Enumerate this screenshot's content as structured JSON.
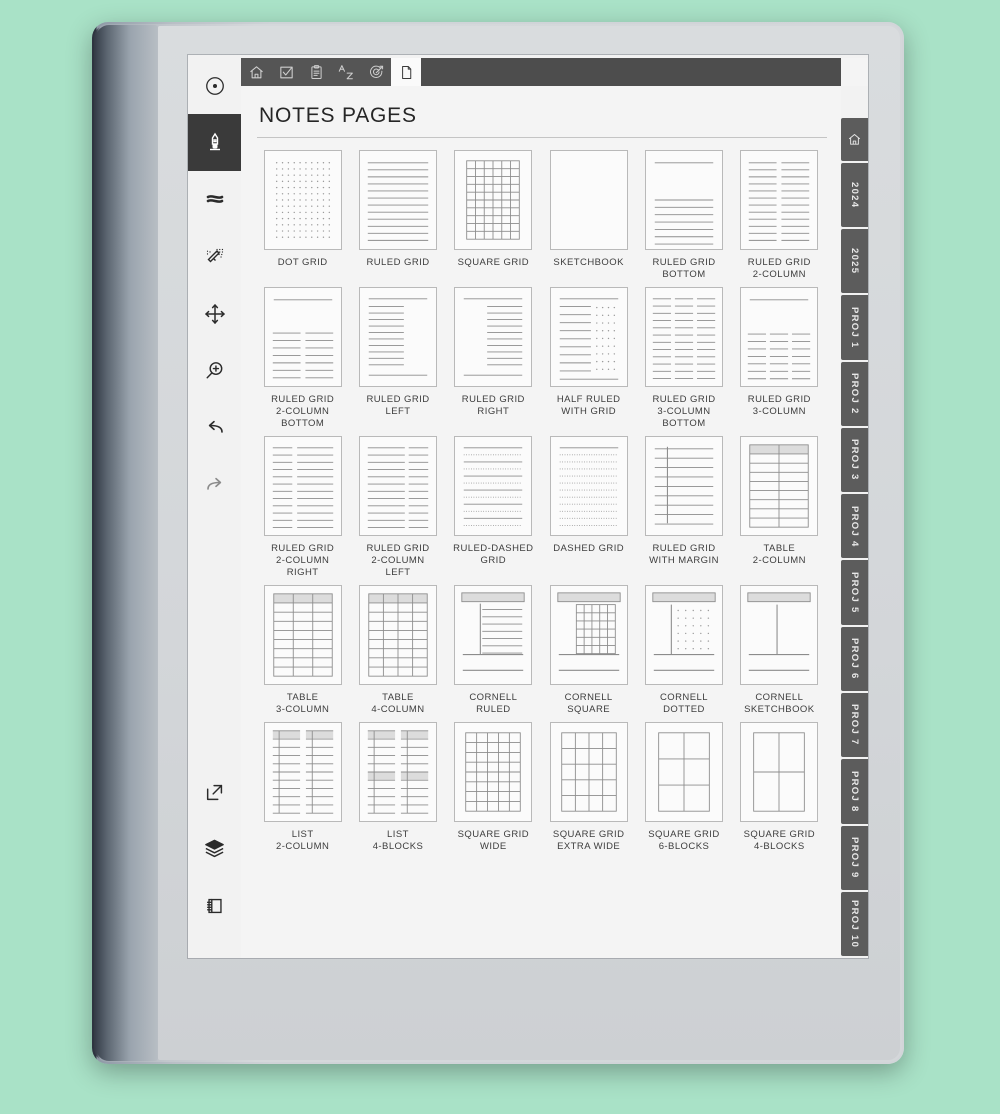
{
  "device": {
    "frame_color": "#d4d7da",
    "background_color": "#a9e2c7"
  },
  "topbar": {
    "tabs": [
      {
        "name": "home-icon",
        "label": "Home",
        "active": false
      },
      {
        "name": "checkbox-icon",
        "label": "Tasks",
        "active": false
      },
      {
        "name": "clipboard-icon",
        "label": "Clipboard",
        "active": false
      },
      {
        "name": "az-sort-icon",
        "label": "A-Z",
        "active": false
      },
      {
        "name": "target-icon",
        "label": "Goals",
        "active": false
      },
      {
        "name": "page-icon",
        "label": "Pages",
        "active": true
      }
    ]
  },
  "toolbar": {
    "items": [
      {
        "name": "record-dot-icon",
        "label": "Selector",
        "active": false,
        "dim": false
      },
      {
        "name": "pen-icon",
        "label": "Pen",
        "active": true,
        "dim": false
      },
      {
        "name": "highlighter-icon",
        "label": "Highlighter",
        "active": false,
        "dim": false
      },
      {
        "name": "eraser-icon",
        "label": "Eraser",
        "active": false,
        "dim": false
      },
      {
        "name": "move-icon",
        "label": "Move",
        "active": false,
        "dim": false
      },
      {
        "name": "zoom-in-icon",
        "label": "Zoom",
        "active": false,
        "dim": false
      },
      {
        "name": "undo-icon",
        "label": "Undo",
        "active": false,
        "dim": false
      },
      {
        "name": "redo-icon",
        "label": "Redo",
        "active": false,
        "dim": true
      }
    ],
    "bottom_items": [
      {
        "name": "export-icon",
        "label": "Export"
      },
      {
        "name": "layers-icon",
        "label": "Layers"
      },
      {
        "name": "notebook-icon",
        "label": "Notebook"
      }
    ]
  },
  "main": {
    "title": "NOTES PAGES",
    "templates": [
      {
        "label": "DOT GRID",
        "style": "dot-grid"
      },
      {
        "label": "RULED GRID",
        "style": "ruled"
      },
      {
        "label": "SQUARE GRID",
        "style": "square-grid"
      },
      {
        "label": "SKETCHBOOK",
        "style": "blank"
      },
      {
        "label": "RULED GRID\nBOTTOM",
        "style": "ruled-bottom"
      },
      {
        "label": "RULED GRID\n2-COLUMN",
        "style": "ruled-2col"
      },
      {
        "label": "RULED GRID\n2-COLUMN\nBOTTOM",
        "style": "ruled-2col-bottom"
      },
      {
        "label": "RULED GRID\nLEFT",
        "style": "ruled-left"
      },
      {
        "label": "RULED GRID\nRIGHT",
        "style": "ruled-right"
      },
      {
        "label": "HALF RULED\nWITH GRID",
        "style": "half-ruled-grid"
      },
      {
        "label": "RULED GRID\n3-COLUMN\nBOTTOM",
        "style": "ruled-3col"
      },
      {
        "label": "RULED GRID\n3-COLUMN",
        "style": "ruled-3col-bottom"
      },
      {
        "label": "RULED GRID\n2-COLUMN\nRIGHT",
        "style": "ruled-2col-r"
      },
      {
        "label": "RULED GRID\n2-COLUMN\nLEFT",
        "style": "ruled-2col-l"
      },
      {
        "label": "RULED-DASHED\nGRID",
        "style": "ruled-dashed"
      },
      {
        "label": "DASHED GRID",
        "style": "dashed"
      },
      {
        "label": "RULED GRID\nWITH MARGIN",
        "style": "ruled-margin"
      },
      {
        "label": "TABLE\n2-COLUMN",
        "style": "table-2"
      },
      {
        "label": "TABLE\n3-COLUMN",
        "style": "table-3"
      },
      {
        "label": "TABLE\n4-COLUMN",
        "style": "table-4"
      },
      {
        "label": "CORNELL\nRULED",
        "style": "cornell-ruled"
      },
      {
        "label": "CORNELL\nSQUARE",
        "style": "cornell-square"
      },
      {
        "label": "CORNELL\nDOTTED",
        "style": "cornell-dotted"
      },
      {
        "label": "CORNELL\nSKETCHBOOK",
        "style": "cornell-blank"
      },
      {
        "label": "LIST\n2-COLUMN",
        "style": "list-2col"
      },
      {
        "label": "LIST\n4-BLOCKS",
        "style": "list-4blocks"
      },
      {
        "label": "SQUARE GRID\nWIDE",
        "style": "square-wide"
      },
      {
        "label": "SQUARE GRID\nEXTRA WIDE",
        "style": "square-xwide"
      },
      {
        "label": "SQUARE GRID\n6-BLOCKS",
        "style": "square-6"
      },
      {
        "label": "SQUARE GRID\n4-BLOCKS",
        "style": "square-4"
      }
    ]
  },
  "side_tabs": [
    {
      "label": "",
      "icon": "home-icon"
    },
    {
      "label": "2024",
      "icon": ""
    },
    {
      "label": "2025",
      "icon": ""
    },
    {
      "label": "PROJ 1",
      "icon": ""
    },
    {
      "label": "PROJ 2",
      "icon": ""
    },
    {
      "label": "PROJ 3",
      "icon": ""
    },
    {
      "label": "PROJ 4",
      "icon": ""
    },
    {
      "label": "PROJ 5",
      "icon": ""
    },
    {
      "label": "PROJ 6",
      "icon": ""
    },
    {
      "label": "PROJ 7",
      "icon": ""
    },
    {
      "label": "PROJ 8",
      "icon": ""
    },
    {
      "label": "PROJ 9",
      "icon": ""
    },
    {
      "label": "PROJ 10",
      "icon": ""
    }
  ]
}
